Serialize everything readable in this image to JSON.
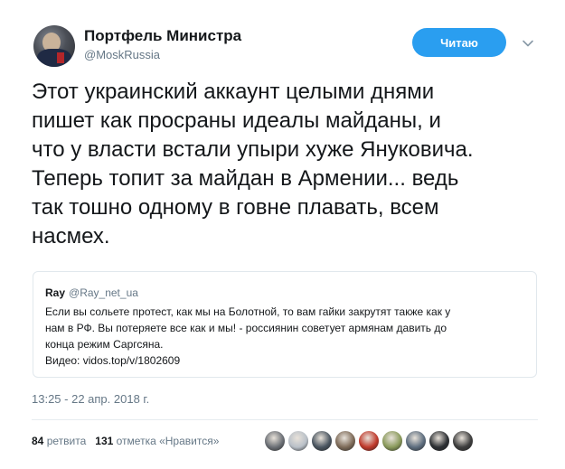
{
  "author": {
    "display_name": "Портфель Министра",
    "username": "@MoskRussia"
  },
  "follow_button_label": "Читаю",
  "tweet_lines": [
    "Этот украинский аккаунт целыми днями",
    "пишет как просраны идеалы майданы, и",
    "что у власти встали упыри хуже Януковича.",
    "Теперь топит за майдан в Армении... ведь",
    "так тошно одному в говне плавать, всем",
    "насмех."
  ],
  "quoted_tweet": {
    "name": "Ray",
    "username": "@Ray_net_ua",
    "lines": [
      "Если вы сольете протест, как мы на Болотной, то вам гайки закрутят также как у",
      "нам в РФ. Вы потеряете все как и мы! - россиянин советует армянам давить до",
      "конца режим Саргсяна.",
      "Видео: vidos.top/v/1802609"
    ]
  },
  "timestamp": "13:25 - 22 апр. 2018 г.",
  "stats": {
    "retweets_count": "84",
    "retweets_label": "ретвита",
    "likes_count": "131",
    "likes_label": "отметка «Нравится»"
  },
  "liker_avatars": [
    {
      "icon": "liker-avatar-icon",
      "color": "#6b6f75"
    },
    {
      "icon": "liker-avatar-icon",
      "color": "#b9c0c8"
    },
    {
      "icon": "liker-avatar-icon",
      "color": "#4a5560"
    },
    {
      "icon": "liker-avatar-icon",
      "color": "#7d6a58"
    },
    {
      "icon": "liker-avatar-icon",
      "color": "#c0392b"
    },
    {
      "icon": "liker-avatar-icon",
      "color": "#8a9a5b"
    },
    {
      "icon": "liker-avatar-icon",
      "color": "#5d6d7e"
    },
    {
      "icon": "liker-avatar-icon",
      "color": "#2c2f33"
    },
    {
      "icon": "liker-avatar-icon",
      "color": "#3d3d3d"
    }
  ],
  "colors": {
    "accent": "#2a9ef0",
    "text": "#14171a",
    "muted": "#657786",
    "border": "#e1e8ed"
  }
}
